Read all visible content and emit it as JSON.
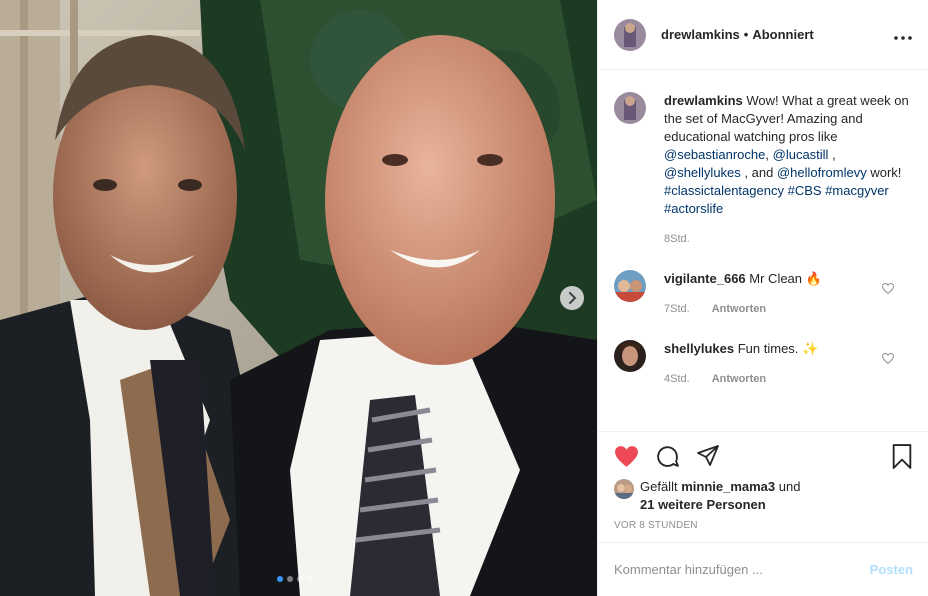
{
  "photo": {
    "next_icon": "chevron-right-icon",
    "carousel_dots": 4,
    "active_dot": 1
  },
  "header": {
    "username": "drewlamkins",
    "separator": "•",
    "follow_status": "Abonniert",
    "more_icon": "more-horizontal-icon",
    "more_label": "•••"
  },
  "caption": {
    "username": "drewlamkins",
    "text_1": "Wow! What a great week on the set of MacGyver! Amazing and educational watching pros like",
    "mention_1": "@sebastianroche",
    "sep_1": ",",
    "mention_2": "@lucastill",
    "sep_2": ",",
    "mention_3": "@shellylukes",
    "sep_3": ", and",
    "mention_4": "@hellofromlevy",
    "text_2": "work!",
    "hashtag_1": "#classictalentagency",
    "hashtag_2": "#CBS",
    "hashtag_3": "#macgyver",
    "hashtag_4": "#actorslife",
    "time": "8Std."
  },
  "comments": [
    {
      "username": "vigilante_666",
      "text": "Mr Clean 🔥",
      "time": "7Std.",
      "reply_label": "Antworten"
    },
    {
      "username": "shellylukes",
      "text": "Fun times. ✨",
      "time": "4Std.",
      "reply_label": "Antworten"
    }
  ],
  "actions": {
    "liked": true,
    "like_color": "#ed4956",
    "icons": [
      "heart-icon",
      "comment-icon",
      "share-icon",
      "bookmark-icon"
    ]
  },
  "likes": {
    "prefix": "Gefällt",
    "user": "minnie_mama3",
    "joiner": "und",
    "others": "21 weitere Personen"
  },
  "time_ago": "VOR 8 STUNDEN",
  "add_comment": {
    "placeholder": "Kommentar hinzufügen ...",
    "post_label": "Posten",
    "post_color": "#b2dffc"
  }
}
